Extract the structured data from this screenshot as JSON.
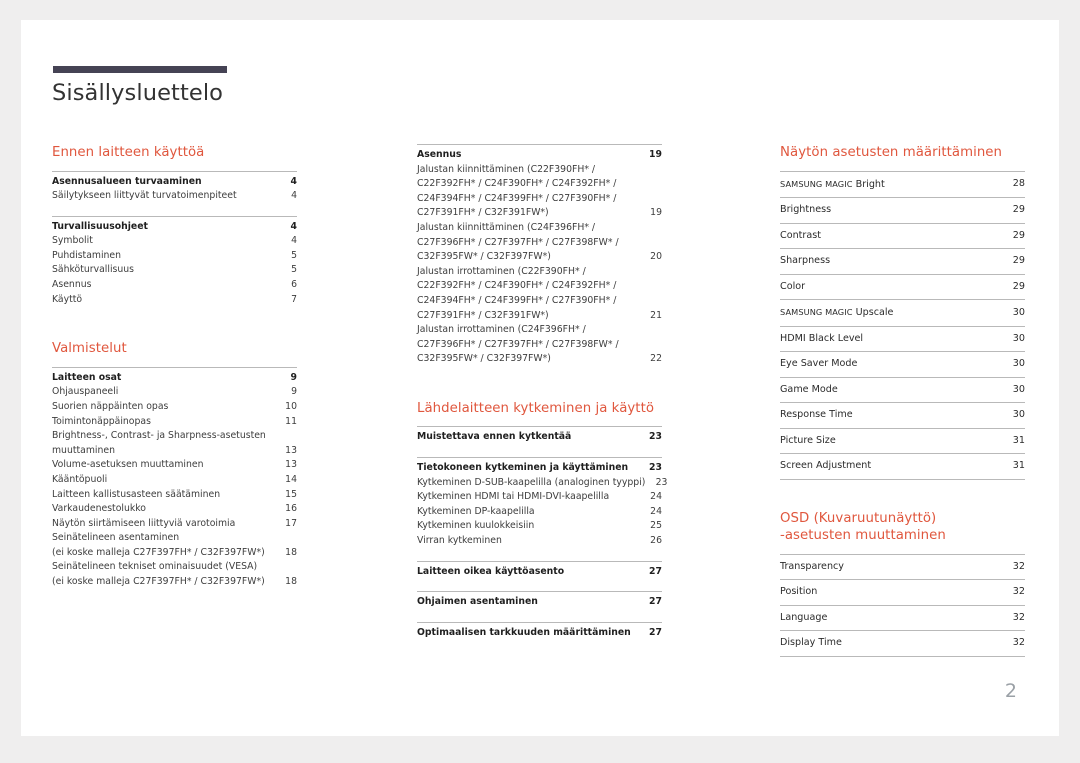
{
  "document": {
    "title": "Sisällysluettelo",
    "page_number": "2",
    "accent_color": "#e0573e",
    "rule_color": "#454354"
  },
  "columns": [
    {
      "id": "column-left",
      "sections": [
        {
          "heading": "Ennen laitteen käyttöä",
          "groups": [
            {
              "entries": [
                {
                  "label": "Asennusalueen turvaaminen",
                  "page": "4",
                  "bold": true
                },
                {
                  "label": "Säilytykseen liittyvät turvatoimenpiteet",
                  "page": "4",
                  "bold": false
                }
              ]
            },
            {
              "entries": [
                {
                  "label": "Turvallisuusohjeet",
                  "page": "4",
                  "bold": true
                },
                {
                  "label": "Symbolit",
                  "page": "4",
                  "bold": false
                },
                {
                  "label": "Puhdistaminen",
                  "page": "5",
                  "bold": false
                },
                {
                  "label": "Sähköturvallisuus",
                  "page": "5",
                  "bold": false
                },
                {
                  "label": "Asennus",
                  "page": "6",
                  "bold": false
                },
                {
                  "label": "Käyttö",
                  "page": "7",
                  "bold": false
                }
              ]
            }
          ]
        },
        {
          "heading": "Valmistelut",
          "groups": [
            {
              "entries": [
                {
                  "label": "Laitteen osat",
                  "page": "9",
                  "bold": true
                },
                {
                  "label": "Ohjauspaneeli",
                  "page": "9",
                  "bold": false
                },
                {
                  "label": "Suorien näppäinten opas",
                  "page": "10",
                  "bold": false
                },
                {
                  "label": "Toimintonäppäinopas",
                  "page": "11",
                  "bold": false
                },
                {
                  "label": "Brightness-, Contrast- ja Sharpness-asetusten muuttaminen",
                  "page": "13",
                  "bold": false,
                  "multiline": true
                },
                {
                  "label": "Volume-asetuksen muuttaminen",
                  "page": "13",
                  "bold": false
                },
                {
                  "label": "Kääntöpuoli",
                  "page": "14",
                  "bold": false
                },
                {
                  "label": "Laitteen kallistusasteen säätäminen",
                  "page": "15",
                  "bold": false
                },
                {
                  "label": "Varkaudenestolukko",
                  "page": "16",
                  "bold": false
                },
                {
                  "label": "Näytön siirtämiseen liittyviä varotoimia",
                  "page": "17",
                  "bold": false
                },
                {
                  "label": "Seinätelineen asentaminen\n(ei koske malleja C27F397FH* / C32F397FW*)",
                  "page": "18",
                  "bold": false,
                  "multiline": true
                },
                {
                  "label": "Seinätelineen tekniset ominaisuudet (VESA)\n(ei koske malleja C27F397FH* / C32F397FW*)",
                  "page": "18",
                  "bold": false,
                  "multiline": true
                }
              ]
            }
          ]
        }
      ]
    },
    {
      "id": "column-middle",
      "sections": [
        {
          "heading": "",
          "groups": [
            {
              "entries": [
                {
                  "label": "Asennus",
                  "page": "19",
                  "bold": true
                },
                {
                  "label": "Jalustan kiinnittäminen (C22F390FH* / C22F392FH* / C24F390FH* / C24F392FH* / C24F394FH* / C24F399FH* / C27F390FH* / C27F391FH* / C32F391FW*)",
                  "page": "19",
                  "bold": false,
                  "multiline": true
                },
                {
                  "label": "Jalustan kiinnittäminen (C24F396FH* / C27F396FH* / C27F397FH* / C27F398FW* / C32F395FW* / C32F397FW*)",
                  "page": "20",
                  "bold": false,
                  "multiline": true
                },
                {
                  "label": "Jalustan irrottaminen (C22F390FH* / C22F392FH* / C24F390FH* / C24F392FH* / C24F394FH* / C24F399FH* / C27F390FH* / C27F391FH* / C32F391FW*)",
                  "page": "21",
                  "bold": false,
                  "multiline": true
                },
                {
                  "label": "Jalustan irrottaminen (C24F396FH* / C27F396FH* / C27F397FH* / C27F398FW* / C32F395FW* / C32F397FW*)",
                  "page": "22",
                  "bold": false,
                  "multiline": true
                }
              ]
            }
          ]
        },
        {
          "heading": "Lähdelaitteen kytkeminen ja käyttö",
          "groups": [
            {
              "entries": [
                {
                  "label": "Muistettava ennen kytkentää",
                  "page": "23",
                  "bold": true
                }
              ]
            },
            {
              "entries": [
                {
                  "label": "Tietokoneen kytkeminen ja käyttäminen",
                  "page": "23",
                  "bold": true
                },
                {
                  "label": "Kytkeminen D-SUB-kaapelilla (analoginen tyyppi)",
                  "page": "23",
                  "bold": false
                },
                {
                  "label": "Kytkeminen HDMI tai HDMI-DVI-kaapelilla",
                  "page": "24",
                  "bold": false
                },
                {
                  "label": "Kytkeminen DP-kaapelilla",
                  "page": "24",
                  "bold": false
                },
                {
                  "label": "Kytkeminen kuulokkeisiin",
                  "page": "25",
                  "bold": false
                },
                {
                  "label": "Virran kytkeminen",
                  "page": "26",
                  "bold": false
                }
              ]
            },
            {
              "entries": [
                {
                  "label": "Laitteen oikea käyttöasento",
                  "page": "27",
                  "bold": true
                }
              ]
            },
            {
              "entries": [
                {
                  "label": "Ohjaimen asentaminen",
                  "page": "27",
                  "bold": true
                }
              ]
            },
            {
              "entries": [
                {
                  "label": "Optimaalisen tarkkuuden määrittäminen",
                  "page": "27",
                  "bold": true
                }
              ]
            }
          ]
        }
      ]
    },
    {
      "id": "column-right",
      "sections": [
        {
          "heading": "Näytön asetusten määrittäminen",
          "bands": [
            {
              "label": "SAMSUNG MAGIC Bright",
              "label_caps": "SAMSUNG MAGIC",
              "label_rest": " Bright",
              "page": "28"
            },
            {
              "label": "Brightness",
              "page": "29"
            },
            {
              "label": "Contrast",
              "page": "29"
            },
            {
              "label": "Sharpness",
              "page": "29"
            },
            {
              "label": "Color",
              "page": "29"
            },
            {
              "label": "SAMSUNG MAGIC Upscale",
              "label_caps": "SAMSUNG MAGIC",
              "label_rest": " Upscale",
              "page": "30"
            },
            {
              "label": "HDMI Black Level",
              "page": "30"
            },
            {
              "label": "Eye Saver Mode",
              "page": "30"
            },
            {
              "label": "Game Mode",
              "page": "30"
            },
            {
              "label": "Response Time",
              "page": "30"
            },
            {
              "label": "Picture Size",
              "page": "31"
            },
            {
              "label": "Screen Adjustment",
              "page": "31"
            }
          ]
        },
        {
          "heading": "OSD (Kuvaruutunäyttö)\n-asetusten muuttaminen",
          "bands": [
            {
              "label": "Transparency",
              "page": "32"
            },
            {
              "label": "Position",
              "page": "32"
            },
            {
              "label": "Language",
              "page": "32"
            },
            {
              "label": "Display Time",
              "page": "32"
            }
          ]
        }
      ]
    }
  ]
}
